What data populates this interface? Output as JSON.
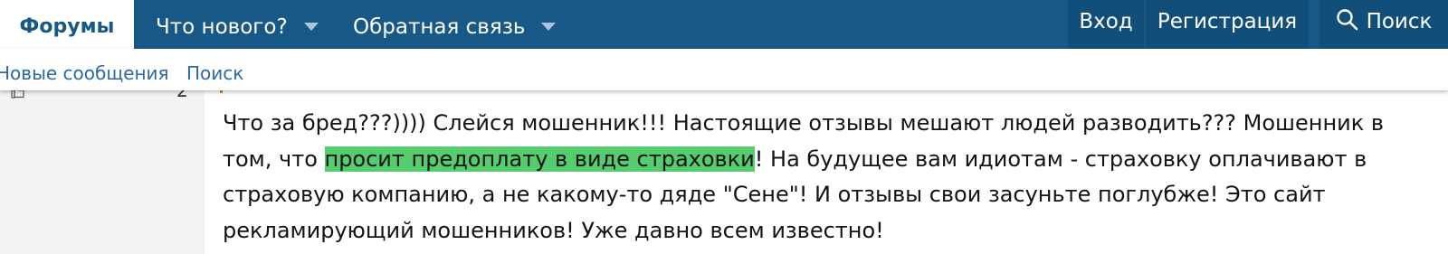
{
  "nav": {
    "tabs": [
      {
        "label": "Форумы"
      },
      {
        "label": "Что нового?"
      },
      {
        "label": "Обратная связь"
      }
    ],
    "login": "Вход",
    "register": "Регистрация",
    "search": "Поиск"
  },
  "subnav": {
    "links": [
      {
        "label": "Новые сообщения"
      },
      {
        "label": "Поиск"
      }
    ]
  },
  "post": {
    "reaction_count": "2",
    "text_before": "Что за бред???)))) Слейся мошенник!!! Настоящие отзывы мешают людей разводить??? Мошенник в том, что ",
    "highlight": "просит предоплату в виде страховки",
    "text_after": "! На будущее вам идиотам - страховку оплачивают в страховую компанию, а не какому-то дяде \"Сене\"! И отзывы свои засуньте поглубже! Это сайт рекламирующий мошенников! Уже давно всем известно!"
  },
  "colors": {
    "header_bg": "#185886",
    "highlight": "#55cc6d",
    "link": "#2b6aa5"
  }
}
